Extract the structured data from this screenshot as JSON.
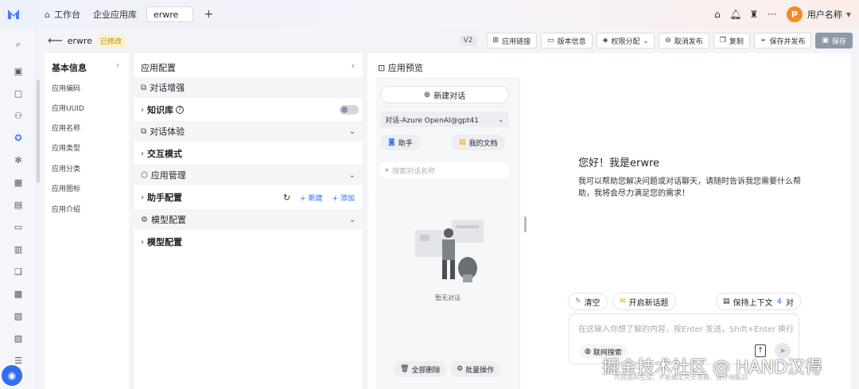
{
  "topbar": {
    "tabs": [
      {
        "label": "工作台",
        "icon": "home-icon"
      },
      {
        "label": "企业应用库",
        "icon": ""
      },
      {
        "label": "erwre",
        "icon": ""
      }
    ],
    "username": "用户名称",
    "avatar_letter": "P"
  },
  "subheader": {
    "app_name": "erwre",
    "status_badge": "已修改",
    "version": "V2",
    "actions": [
      "应用链接",
      "版本信息",
      "权限分配",
      "取消发布",
      "复制",
      "保存并发布",
      "保存"
    ]
  },
  "info_panel": {
    "title": "基本信息",
    "fields": [
      "应用编码",
      "应用UUID",
      "应用名称",
      "应用类型",
      "应用分类",
      "应用图标",
      "应用介绍"
    ]
  },
  "config_panel": {
    "title": "应用配置",
    "rows": [
      {
        "label": "对话增强",
        "kind": "section"
      },
      {
        "label": "知识库",
        "kind": "group"
      },
      {
        "label": "对话体验",
        "kind": "section"
      },
      {
        "label": "交互模式",
        "kind": "group"
      },
      {
        "label": "应用管理",
        "kind": "section"
      },
      {
        "label": "助手配置",
        "kind": "group"
      },
      {
        "label": "模型配置",
        "kind": "section"
      },
      {
        "label": "模型配置",
        "kind": "group"
      }
    ],
    "assistant_actions": {
      "new": "新建",
      "add": "添加"
    }
  },
  "preview": {
    "title": "应用预览",
    "new_chat": "新建对话",
    "model": "对话-Azure OpenAI@gpt41",
    "chip_assistant": "助手",
    "chip_docs": "我的文档",
    "search_placeholder": "搜索对话名称",
    "empty_text": "暂无对话",
    "delete_all": "全部删除",
    "batch_ops": "批量操作",
    "welcome_title": "您好！我是erwre",
    "welcome_body": "我可以帮助您解决问题或对话聊天，请随时告诉我您需要什么帮助，我将会尽力满足您的需求！",
    "clear": "清空",
    "new_topic": "开启新话题",
    "keep_context": "保持上下文",
    "context_count": "4",
    "context_unit": "对",
    "input_placeholder": "在这输入你想了解的内容，按Enter 发送，Shift+Enter 换行",
    "web_search": "联网搜索",
    "disclaimer": "内容由AI生成，不能确定完全准确，请仔细甄别"
  },
  "watermark": "掘金技术社区 @ HAND汉得"
}
